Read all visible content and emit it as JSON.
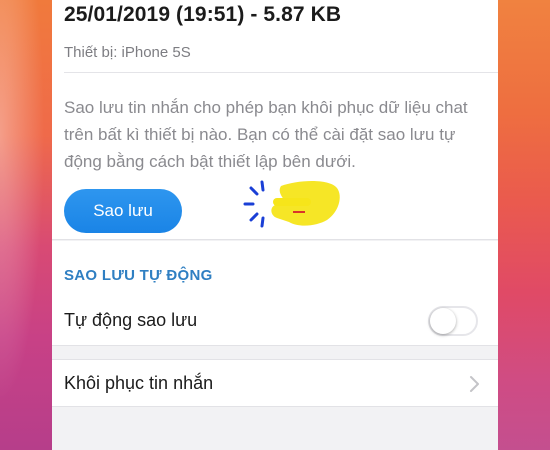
{
  "backup": {
    "date_size": "25/01/2019 (19:51) - 5.87 KB",
    "device": "Thiết bị: iPhone 5S",
    "description": "Sao lưu tin nhắn cho phép bạn khôi phục dữ liệu chat trên bất kì thiết bị nào. Bạn có thể cài đặt sao lưu tự động bằng cách bật thiết lập bên dưới.",
    "button_label": "Sao lưu"
  },
  "auto_backup": {
    "section_title": "SAO LƯU TỰ ĐỘNG",
    "toggle_label": "Tự động sao lưu",
    "toggle_on": false
  },
  "restore": {
    "label": "Khôi phục tin nhắn"
  },
  "colors": {
    "accent": "#1a84e6",
    "section_header": "#2f7fc2",
    "highlight": "#f6e51a"
  }
}
